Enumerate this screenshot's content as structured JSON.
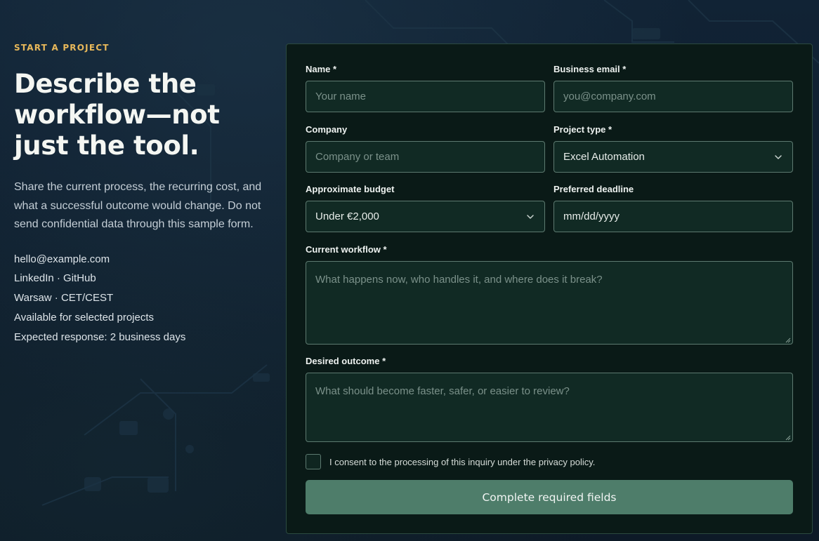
{
  "intro_section": {
    "eyebrow": "START A PROJECT",
    "headline": "Describe the workflow—not just the tool.",
    "description": "Share the current process, the recurring cost, and what a successful outcome would change. Do not send confidential data through this sample form.",
    "contacts": {
      "email": "hello@example.com",
      "social": "LinkedIn · GitHub",
      "location": "Warsaw · CET/CEST",
      "availability": "Available for selected projects",
      "response": "Expected response: 2 business days"
    }
  },
  "form": {
    "name": {
      "label": "Name *",
      "placeholder": "Your name"
    },
    "email": {
      "label": "Business email *",
      "placeholder": "you@company.com"
    },
    "company": {
      "label": "Company",
      "placeholder": "Company or team"
    },
    "project_type": {
      "label": "Project type *",
      "value": "Excel Automation"
    },
    "budget": {
      "label": "Approximate budget",
      "value": "Under €2,000"
    },
    "deadline": {
      "label": "Preferred deadline",
      "value": "mm/dd/yyyy"
    },
    "workflow": {
      "label": "Current workflow *",
      "placeholder": "What happens now, who handles it, and where does it break?"
    },
    "outcome": {
      "label": "Desired outcome *",
      "placeholder": "What should become faster, safer, or easier to review?"
    },
    "consent_label": "I consent to the processing of this inquiry under the privacy policy.",
    "submit_label": "Complete required fields"
  },
  "colors": {
    "accent": "#e8b85a",
    "card_background": "#0a1a17",
    "input_border": "#5d7a70",
    "submit_button": "#4e7d6a"
  }
}
